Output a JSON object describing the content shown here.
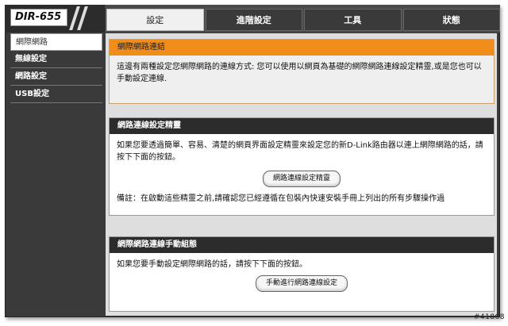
{
  "header": {
    "model": "DIR-655"
  },
  "tabs": [
    {
      "label": "設定",
      "active": true
    },
    {
      "label": "進階設定",
      "active": false
    },
    {
      "label": "工具",
      "active": false
    },
    {
      "label": "狀態",
      "active": false
    }
  ],
  "sidebar": {
    "items": [
      {
        "label": "網際網路",
        "active": true
      },
      {
        "label": "無線設定",
        "active": false
      },
      {
        "label": "網路設定",
        "active": false
      },
      {
        "label": "USB設定",
        "active": false
      }
    ]
  },
  "intro": {
    "title": "網際網路連結",
    "text": "這邊有兩種設定您網際網路的連線方式: 您可以使用以網頁為基礎的網際網路連線設定精靈,或是您也可以手動設定連線."
  },
  "wizard": {
    "title": "網路連線設定精靈",
    "text": "如果您要透過簡單、容易、清楚的網頁界面設定精靈來設定您的新D-Link路由器以連上網際網路的話，請按下下面的按鈕。",
    "button": "網路連線設定精靈",
    "note": "備註：在啟動這些精靈之前,請確認您已經遵循在包裝內快速安裝手冊上列出的所有步驟操作過"
  },
  "manual": {
    "title": "網際網路連線手動組態",
    "text": "如果您要手動設定網際網路的話，請按下下面的按鈕。",
    "button": "手動進行網路連線設定"
  },
  "watermark": "#41868",
  "colors": {
    "accent": "#f08d1b",
    "dark": "#2c2c2c"
  }
}
